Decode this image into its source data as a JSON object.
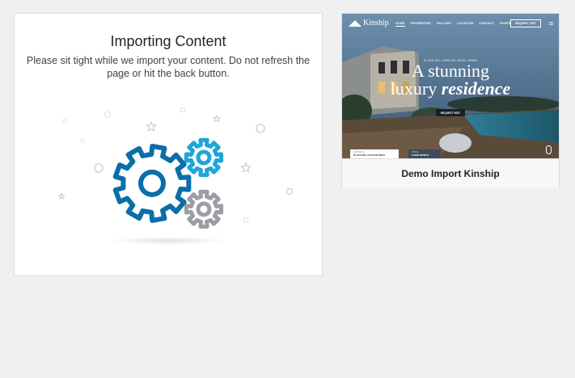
{
  "importer": {
    "title": "Importing Content",
    "description": "Please sit tight while we import your content. Do not refresh the page or hit the back button."
  },
  "demo": {
    "name": "Demo Import Kinship",
    "preview": {
      "brand": "Kinship",
      "nav": [
        "HOME",
        "PROPERTIES",
        "GALLERY",
        "LOCATION",
        "CONTACT",
        "PAGES"
      ],
      "request_button": "REQUEST VISIT",
      "kicker": "PLAYA DEL CASA DE IBIZA, SPAIN",
      "headline_line1": "A stunning",
      "headline_line2_plain": "luxury",
      "headline_line2_emph": "residence",
      "hero_button": "REQUEST VISIT",
      "card1_label": "ADDRESS",
      "card1_value": "PLAYA DEL CASA DE IBIZA",
      "card2_label": "PRICE",
      "card2_value": "$ 9900 MONTH"
    }
  },
  "colors": {
    "gear_large": "#0a6ea8",
    "gear_small_blue": "#1fa5d9",
    "gear_gray": "#9b9ea3"
  }
}
